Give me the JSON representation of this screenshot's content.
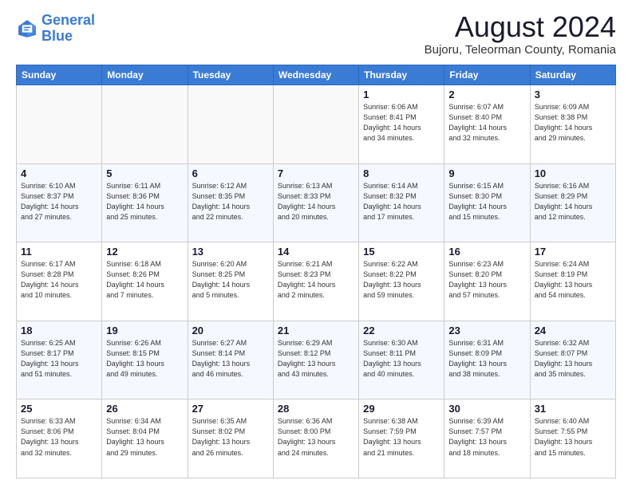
{
  "header": {
    "logo_line1": "General",
    "logo_line2": "Blue",
    "month_year": "August 2024",
    "location": "Bujoru, Teleorman County, Romania"
  },
  "calendar": {
    "days_of_week": [
      "Sunday",
      "Monday",
      "Tuesday",
      "Wednesday",
      "Thursday",
      "Friday",
      "Saturday"
    ],
    "weeks": [
      [
        {
          "day": "",
          "info": ""
        },
        {
          "day": "",
          "info": ""
        },
        {
          "day": "",
          "info": ""
        },
        {
          "day": "",
          "info": ""
        },
        {
          "day": "1",
          "info": "Sunrise: 6:06 AM\nSunset: 8:41 PM\nDaylight: 14 hours\nand 34 minutes."
        },
        {
          "day": "2",
          "info": "Sunrise: 6:07 AM\nSunset: 8:40 PM\nDaylight: 14 hours\nand 32 minutes."
        },
        {
          "day": "3",
          "info": "Sunrise: 6:09 AM\nSunset: 8:38 PM\nDaylight: 14 hours\nand 29 minutes."
        }
      ],
      [
        {
          "day": "4",
          "info": "Sunrise: 6:10 AM\nSunset: 8:37 PM\nDaylight: 14 hours\nand 27 minutes."
        },
        {
          "day": "5",
          "info": "Sunrise: 6:11 AM\nSunset: 8:36 PM\nDaylight: 14 hours\nand 25 minutes."
        },
        {
          "day": "6",
          "info": "Sunrise: 6:12 AM\nSunset: 8:35 PM\nDaylight: 14 hours\nand 22 minutes."
        },
        {
          "day": "7",
          "info": "Sunrise: 6:13 AM\nSunset: 8:33 PM\nDaylight: 14 hours\nand 20 minutes."
        },
        {
          "day": "8",
          "info": "Sunrise: 6:14 AM\nSunset: 8:32 PM\nDaylight: 14 hours\nand 17 minutes."
        },
        {
          "day": "9",
          "info": "Sunrise: 6:15 AM\nSunset: 8:30 PM\nDaylight: 14 hours\nand 15 minutes."
        },
        {
          "day": "10",
          "info": "Sunrise: 6:16 AM\nSunset: 8:29 PM\nDaylight: 14 hours\nand 12 minutes."
        }
      ],
      [
        {
          "day": "11",
          "info": "Sunrise: 6:17 AM\nSunset: 8:28 PM\nDaylight: 14 hours\nand 10 minutes."
        },
        {
          "day": "12",
          "info": "Sunrise: 6:18 AM\nSunset: 8:26 PM\nDaylight: 14 hours\nand 7 minutes."
        },
        {
          "day": "13",
          "info": "Sunrise: 6:20 AM\nSunset: 8:25 PM\nDaylight: 14 hours\nand 5 minutes."
        },
        {
          "day": "14",
          "info": "Sunrise: 6:21 AM\nSunset: 8:23 PM\nDaylight: 14 hours\nand 2 minutes."
        },
        {
          "day": "15",
          "info": "Sunrise: 6:22 AM\nSunset: 8:22 PM\nDaylight: 13 hours\nand 59 minutes."
        },
        {
          "day": "16",
          "info": "Sunrise: 6:23 AM\nSunset: 8:20 PM\nDaylight: 13 hours\nand 57 minutes."
        },
        {
          "day": "17",
          "info": "Sunrise: 6:24 AM\nSunset: 8:19 PM\nDaylight: 13 hours\nand 54 minutes."
        }
      ],
      [
        {
          "day": "18",
          "info": "Sunrise: 6:25 AM\nSunset: 8:17 PM\nDaylight: 13 hours\nand 51 minutes."
        },
        {
          "day": "19",
          "info": "Sunrise: 6:26 AM\nSunset: 8:15 PM\nDaylight: 13 hours\nand 49 minutes."
        },
        {
          "day": "20",
          "info": "Sunrise: 6:27 AM\nSunset: 8:14 PM\nDaylight: 13 hours\nand 46 minutes."
        },
        {
          "day": "21",
          "info": "Sunrise: 6:29 AM\nSunset: 8:12 PM\nDaylight: 13 hours\nand 43 minutes."
        },
        {
          "day": "22",
          "info": "Sunrise: 6:30 AM\nSunset: 8:11 PM\nDaylight: 13 hours\nand 40 minutes."
        },
        {
          "day": "23",
          "info": "Sunrise: 6:31 AM\nSunset: 8:09 PM\nDaylight: 13 hours\nand 38 minutes."
        },
        {
          "day": "24",
          "info": "Sunrise: 6:32 AM\nSunset: 8:07 PM\nDaylight: 13 hours\nand 35 minutes."
        }
      ],
      [
        {
          "day": "25",
          "info": "Sunrise: 6:33 AM\nSunset: 8:06 PM\nDaylight: 13 hours\nand 32 minutes."
        },
        {
          "day": "26",
          "info": "Sunrise: 6:34 AM\nSunset: 8:04 PM\nDaylight: 13 hours\nand 29 minutes."
        },
        {
          "day": "27",
          "info": "Sunrise: 6:35 AM\nSunset: 8:02 PM\nDaylight: 13 hours\nand 26 minutes."
        },
        {
          "day": "28",
          "info": "Sunrise: 6:36 AM\nSunset: 8:00 PM\nDaylight: 13 hours\nand 24 minutes."
        },
        {
          "day": "29",
          "info": "Sunrise: 6:38 AM\nSunset: 7:59 PM\nDaylight: 13 hours\nand 21 minutes."
        },
        {
          "day": "30",
          "info": "Sunrise: 6:39 AM\nSunset: 7:57 PM\nDaylight: 13 hours\nand 18 minutes."
        },
        {
          "day": "31",
          "info": "Sunrise: 6:40 AM\nSunset: 7:55 PM\nDaylight: 13 hours\nand 15 minutes."
        }
      ]
    ]
  }
}
